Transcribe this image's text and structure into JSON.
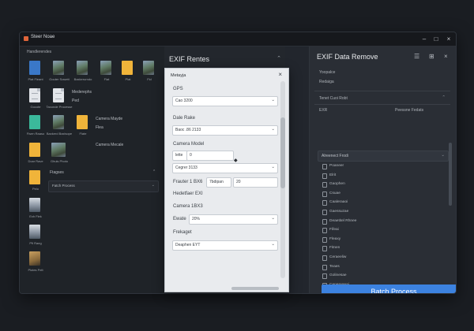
{
  "window": {
    "title": "Steer Noae"
  },
  "files": {
    "header": "Handlerendes",
    "tiles": [
      {
        "label": "Plat Fleant",
        "kind": "blue",
        "glyph": "Ps"
      },
      {
        "label": "Gouter Sowett",
        "kind": "photo"
      },
      {
        "label": "Baxkerurndo",
        "kind": "photo"
      },
      {
        "label": "Flat",
        "kind": "photo"
      },
      {
        "label": "Plat",
        "kind": "yellow"
      },
      {
        "label": "Fid",
        "kind": "photo"
      },
      {
        "label": "Gocote",
        "kind": "doc"
      },
      {
        "label": "Taxonde Processe",
        "kind": "doc"
      },
      {
        "label": "Fisen Raaso",
        "kind": "green"
      },
      {
        "label": "Baxkerd Baxlsope",
        "kind": "photo"
      },
      {
        "label": "Flate",
        "kind": "yellow"
      },
      {
        "label": "Doar Rave",
        "kind": "yellow"
      },
      {
        "label": "Ghuls Photo",
        "kind": "photo"
      },
      {
        "label": "Pelo",
        "kind": "yellow"
      },
      {
        "label": "Exh Flek",
        "kind": "img2"
      },
      {
        "label": "Pfi Raeg",
        "kind": "img2"
      },
      {
        "label": "Plotes Pelt",
        "kind": "img3"
      }
    ],
    "side_labels": [
      "Mederephs",
      "Ped",
      "Camera Mayde",
      "Flea",
      "Camera Mecale",
      "Ftagses"
    ],
    "process_select": "Fatch Process"
  },
  "middle": {
    "title": "EXIF Rentes"
  },
  "dialog": {
    "title": "Metayja",
    "gps_label": "GPS",
    "gps_value": "Cao 3200",
    "date_label": "Dale Rake",
    "date_value": "Baoc .86 2133",
    "camera_label": "Camera Model",
    "camera_field": "lette",
    "camera_num": "0",
    "camera_select": "Cegrer 3133",
    "feature_label": "Frauter 1 BX6",
    "feature_value": "7bdipan",
    "feature_num": "20",
    "header_exif": "Hedetfaer EXI",
    "camera2_label": "Camera 1BX3",
    "ewate_label": "Ewate",
    "ewate_value": "20%",
    "frekaget_label": "Frekaget",
    "frekaget_value": "Deaphen EYT"
  },
  "right": {
    "title": "EXIF Data Remove",
    "subtitle1": "Yoopalce",
    "subtitle2": "Redaiga",
    "row1": {
      "k": "Tenet Cuoi Robt"
    },
    "row2": {
      "k": "EXR",
      "v": "Peessne Fedats"
    },
    "advanced": "Alreenect Frodi",
    "list": [
      "Poaneer",
      "Elrit",
      "Gaophen",
      "Csuae",
      "Caaleraaoi",
      "Gaessuzae",
      "Deaetitel Rhnee",
      "Fifeai",
      "Fleaxy",
      "Fitnen",
      "Ceraeeliw",
      "Teaes",
      "Golinesae",
      "Ceneregeai"
    ],
    "button": "Batch Process"
  }
}
